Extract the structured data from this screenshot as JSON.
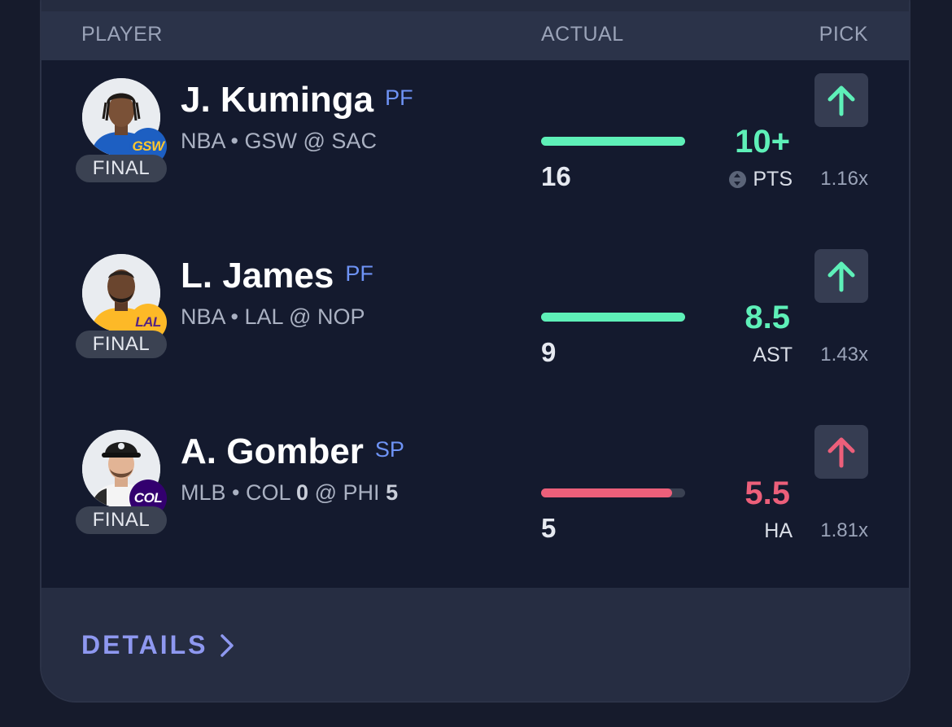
{
  "header": {
    "player_label": "PLAYER",
    "actual_label": "ACTUAL",
    "pick_label": "PICK"
  },
  "colors": {
    "hit": "#5ef0b8",
    "miss": "#ec5f7a"
  },
  "rows": [
    {
      "name": "J. Kuminga",
      "position": "PF",
      "league": "NBA",
      "separator": "•",
      "matchup": "GSW @ SAC",
      "status": "FINAL",
      "team_badge": "GSW",
      "badge_bg": "#1d5fc2",
      "badge_fg": "#ffc72c",
      "actual": "16",
      "progress_fraction": 1.0,
      "status_color": "hit",
      "line": "10+",
      "stat": "PTS",
      "show_alt_icon": true,
      "direction_icon": "arrow-up-icon",
      "multiplier": "1.16x"
    },
    {
      "name": "L. James",
      "position": "PF",
      "league": "NBA",
      "separator": "•",
      "matchup": "LAL @ NOP",
      "status": "FINAL",
      "team_badge": "LAL",
      "badge_bg": "#fdb927",
      "badge_fg": "#552583",
      "actual": "9",
      "progress_fraction": 1.0,
      "status_color": "hit",
      "line": "8.5",
      "stat": "AST",
      "show_alt_icon": false,
      "direction_icon": "arrow-up-icon",
      "multiplier": "1.43x"
    },
    {
      "name": "A. Gomber",
      "position": "SP",
      "league": "MLB",
      "separator": "•",
      "matchup_away_team": "COL",
      "matchup_away_score": "0",
      "matchup_at": "@",
      "matchup_home_team": "PHI",
      "matchup_home_score": "5",
      "status": "FINAL",
      "team_badge": "COL",
      "badge_bg": "#33006f",
      "badge_fg": "#ffffff",
      "actual": "5",
      "progress_fraction": 0.91,
      "status_color": "miss",
      "line": "5.5",
      "stat": "HA",
      "show_alt_icon": false,
      "direction_icon": "arrow-up-icon",
      "multiplier": "1.81x"
    }
  ],
  "footer": {
    "details_label": "DETAILS",
    "details_icon": "chevron-right-icon"
  }
}
